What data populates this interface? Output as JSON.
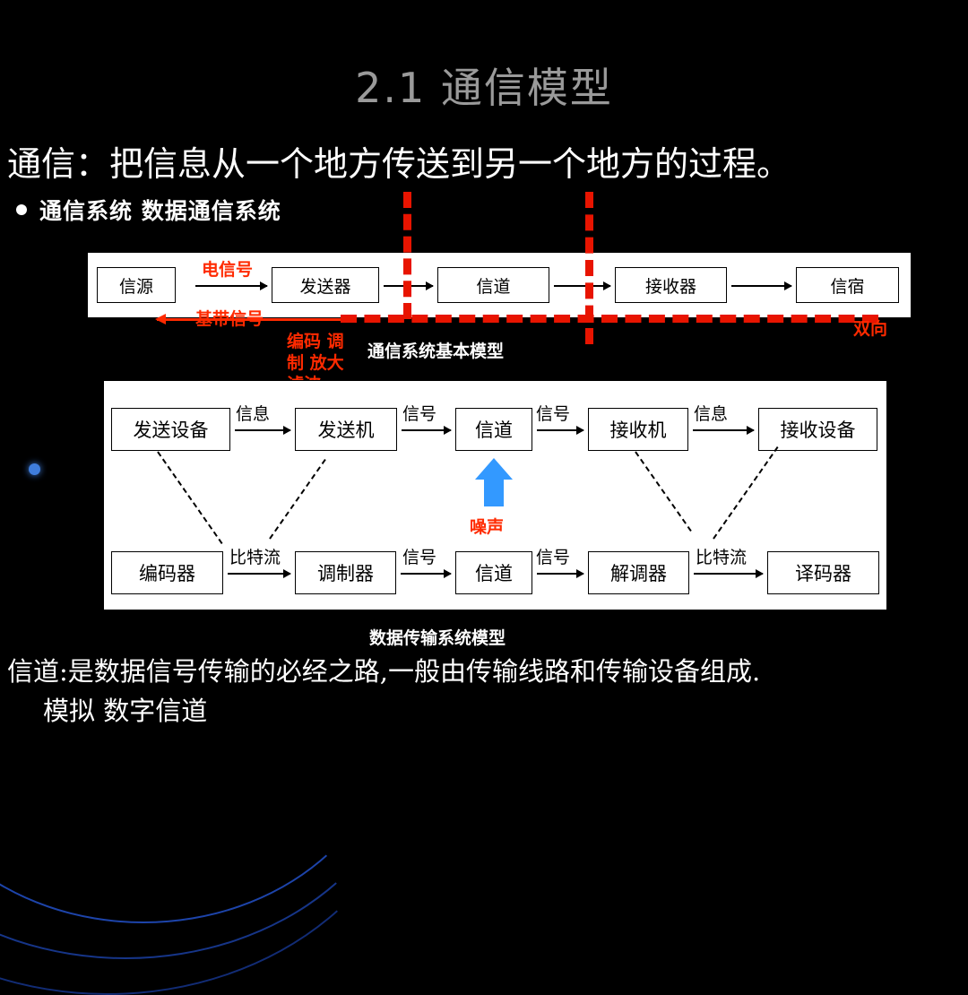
{
  "slide": {
    "title": "2.1 通信模型",
    "lead": "通信：把信息从一个地方传送到另一个地方的过程。",
    "bullet": "通信系统    数据通信系统",
    "caption1": "通信系统基本模型",
    "caption2": "数据传输系统模型",
    "bottom_line1": "信道:是数据信号传输的必经之路,一般由传输线路和传输设备组成.",
    "bottom_line2": "模拟 数字信道"
  },
  "diagram1": {
    "boxes": [
      {
        "label": "信源"
      },
      {
        "label": "发送器"
      },
      {
        "label": "信道"
      },
      {
        "label": "接收器"
      },
      {
        "label": "信宿"
      }
    ],
    "red_labels": {
      "电信号": "电信号",
      "基带信号": "基带信号",
      "编码调制放大滤波_l1": "编码 调",
      "编码调制放大滤波_l2": "制 放大",
      "编码调制放大滤波_l3": "滤波",
      "双向": "双向"
    }
  },
  "diagram2": {
    "top_row": [
      {
        "label": "发送设备"
      },
      {
        "label": "发送机"
      },
      {
        "label": "信道"
      },
      {
        "label": "接收机"
      },
      {
        "label": "接收设备"
      }
    ],
    "top_edge_labels": [
      "信息",
      "信号",
      "信号",
      "信息"
    ],
    "bottom_row": [
      {
        "label": "编码器"
      },
      {
        "label": "调制器"
      },
      {
        "label": "信道"
      },
      {
        "label": "解调器"
      },
      {
        "label": "译码器"
      }
    ],
    "bottom_edge_labels": [
      "比特流",
      "信号",
      "信号",
      "比特流"
    ],
    "noise_label": "噪声"
  },
  "colors": {
    "title": "#9a9a9a",
    "red": "#ff2a00",
    "dash_red": "#e81400",
    "noise_blue": "#3399ff",
    "background": "#000000",
    "panel": "#ffffff"
  }
}
